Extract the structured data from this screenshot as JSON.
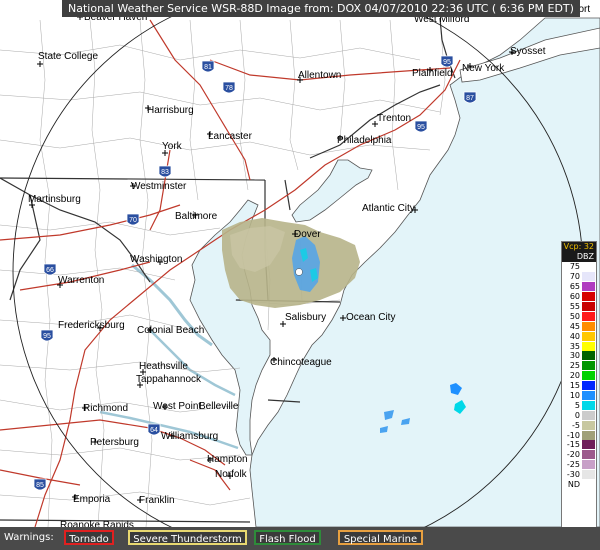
{
  "header": {
    "title": "National Weather Service WSR-88D Image from: DOX 04/07/2010 22:36 UTC ( 6:36 PM EDT)"
  },
  "colors": {
    "ocean": "#e3f4f9",
    "land": "#ffffff",
    "state_border": "#444444",
    "county_line": "#999999",
    "interstate": "#c0392b",
    "range_ring": "#222222",
    "echo_tan": "#b7b48a",
    "echo_blue": "#4aa3f0"
  },
  "cities": [
    {
      "name": "Beaver Haven",
      "label": "Beaver Haven"
    },
    {
      "name": "Westmilford",
      "label": "West Milford"
    },
    {
      "name": "Bridgeport",
      "label": "Bridgeport"
    },
    {
      "name": "State College",
      "label": "State College"
    },
    {
      "name": "Allentown",
      "label": "Allentown"
    },
    {
      "name": "Plainfield",
      "label": "Plainfield"
    },
    {
      "name": "New York",
      "label": "New York"
    },
    {
      "name": "Syosset",
      "label": "Syosset"
    },
    {
      "name": "Harrisburg",
      "label": "Harrisburg"
    },
    {
      "name": "Trenton",
      "label": "Trenton"
    },
    {
      "name": "Lancaster",
      "label": "Lancaster"
    },
    {
      "name": "Philadelphia",
      "label": "Philadelphia"
    },
    {
      "name": "York",
      "label": "York"
    },
    {
      "name": "Westminster",
      "label": "Westminster"
    },
    {
      "name": "Martinsburg",
      "label": "Martinsburg"
    },
    {
      "name": "Atlantic City",
      "label": "Atlantic City"
    },
    {
      "name": "Baltimore",
      "label": "Baltimore"
    },
    {
      "name": "Dover",
      "label": "Dover"
    },
    {
      "name": "Washington",
      "label": "Washington"
    },
    {
      "name": "Warrenton",
      "label": "Warrenton"
    },
    {
      "name": "Salisbury",
      "label": "Salisbury"
    },
    {
      "name": "Ocean City",
      "label": "Ocean City"
    },
    {
      "name": "Fredericksburg",
      "label": "Fredericksburg"
    },
    {
      "name": "Colonial Beach",
      "label": "Colonial Beach"
    },
    {
      "name": "Chincoteague",
      "label": "Chincoteague"
    },
    {
      "name": "Heathsville",
      "label": "Heathsville"
    },
    {
      "name": "Tappahannock",
      "label": "Tappahannock"
    },
    {
      "name": "West Point",
      "label": "West Point"
    },
    {
      "name": "Belleville",
      "label": "Belleville"
    },
    {
      "name": "Richmond",
      "label": "Richmond"
    },
    {
      "name": "Williamsburg",
      "label": "Williamsburg"
    },
    {
      "name": "Petersburg",
      "label": "Petersburg"
    },
    {
      "name": "Hampton",
      "label": "Hampton"
    },
    {
      "name": "Norfolk",
      "label": "Norfolk"
    },
    {
      "name": "Emporia",
      "label": "Emporia"
    },
    {
      "name": "Franklin",
      "label": "Franklin"
    },
    {
      "name": "Roanoke Rapids",
      "label": "Roanoke Rapids"
    }
  ],
  "interstates": [
    "81",
    "78",
    "95",
    "83",
    "70",
    "66",
    "95",
    "64",
    "85",
    "95",
    "87"
  ],
  "legend": {
    "mode_label": "Vcp: 32",
    "unit_label": "DBZ",
    "rows": [
      {
        "label": "75",
        "color": "#ffffff"
      },
      {
        "label": "70",
        "color": "#e6e6fa"
      },
      {
        "label": "65",
        "color": "#b03cc0"
      },
      {
        "label": "60",
        "color": "#d60000"
      },
      {
        "label": "55",
        "color": "#c80000"
      },
      {
        "label": "50",
        "color": "#ff1a1a"
      },
      {
        "label": "45",
        "color": "#ff8c00"
      },
      {
        "label": "40",
        "color": "#ffc800"
      },
      {
        "label": "35",
        "color": "#ffff00"
      },
      {
        "label": "30",
        "color": "#006400"
      },
      {
        "label": "25",
        "color": "#009600"
      },
      {
        "label": "20",
        "color": "#00d200"
      },
      {
        "label": "15",
        "color": "#0028ff"
      },
      {
        "label": "10",
        "color": "#1e90ff"
      },
      {
        "label": "5",
        "color": "#00d8e8"
      },
      {
        "label": "0",
        "color": "#cccccc"
      },
      {
        "label": "-5",
        "color": "#c8c8a0"
      },
      {
        "label": "-10",
        "color": "#a0a078"
      },
      {
        "label": "-15",
        "color": "#6e1e5a"
      },
      {
        "label": "-20",
        "color": "#9c5a8c"
      },
      {
        "label": "-25",
        "color": "#c8a0c8"
      },
      {
        "label": "-30",
        "color": "#e6e6e6"
      },
      {
        "label": "ND",
        "color": "#ffffff"
      }
    ]
  },
  "warnings": {
    "label": "Warnings:",
    "items": [
      {
        "label": "Tornado",
        "color": "#e02020"
      },
      {
        "label": "Severe Thunderstorm",
        "color": "#e8d870"
      },
      {
        "label": "Flash Flood",
        "color": "#2e8b3a"
      },
      {
        "label": "Special Marine",
        "color": "#e8a040"
      }
    ]
  }
}
